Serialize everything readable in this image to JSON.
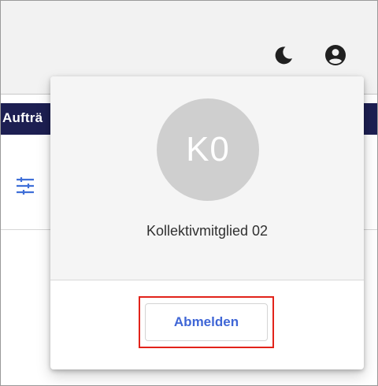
{
  "header": {
    "icons": {
      "theme": "moon-icon",
      "account": "account-circle-icon"
    },
    "colors": {
      "icon": "#202020",
      "background": "#f2f2f2"
    }
  },
  "nav_bar": {
    "label": "Aufträ",
    "color": "#1d1f52"
  },
  "filter": {
    "icon": "tune-sliders-icon",
    "color": "#3f6fd8"
  },
  "user_menu": {
    "avatar_initials": "K0",
    "user_name": "Kollektivmitglied 02",
    "logout_label": "Abmelden",
    "logout_color": "#3f66d6",
    "highlight_color": "#e2231a"
  }
}
